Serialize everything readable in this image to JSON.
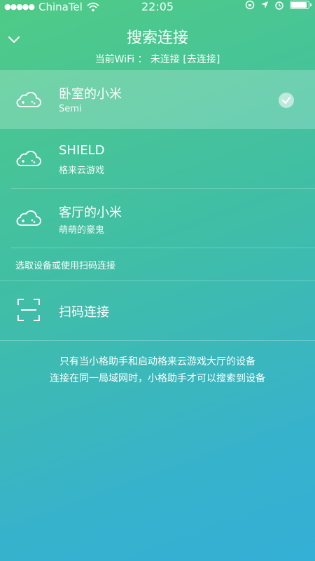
{
  "status_bar": {
    "carrier": "ChinaTel",
    "time": "22:05"
  },
  "header": {
    "title": "搜索连接",
    "subtitle": "当前WiFi ： 未连接 [去连接]"
  },
  "devices": [
    {
      "name": "卧室的小米",
      "sub": "Semi",
      "selected": true,
      "icon": "gamepad-cloud-icon"
    },
    {
      "name": "SHIELD",
      "sub": "格来云游戏",
      "selected": false,
      "icon": "gamepad-cloud-icon"
    },
    {
      "name": "客厅的小米",
      "sub": "萌萌的豪鬼",
      "selected": false,
      "icon": "gamepad-cloud-icon"
    }
  ],
  "section_label": "选取设备或使用扫码连接",
  "scan": {
    "label": "扫码连接",
    "icon": "scan-qr-icon"
  },
  "note": {
    "line1": "只有当小格助手和启动格来云游戏大厅的设备",
    "line2": "连接在同一局域网时，小格助手才可以搜索到设备"
  }
}
